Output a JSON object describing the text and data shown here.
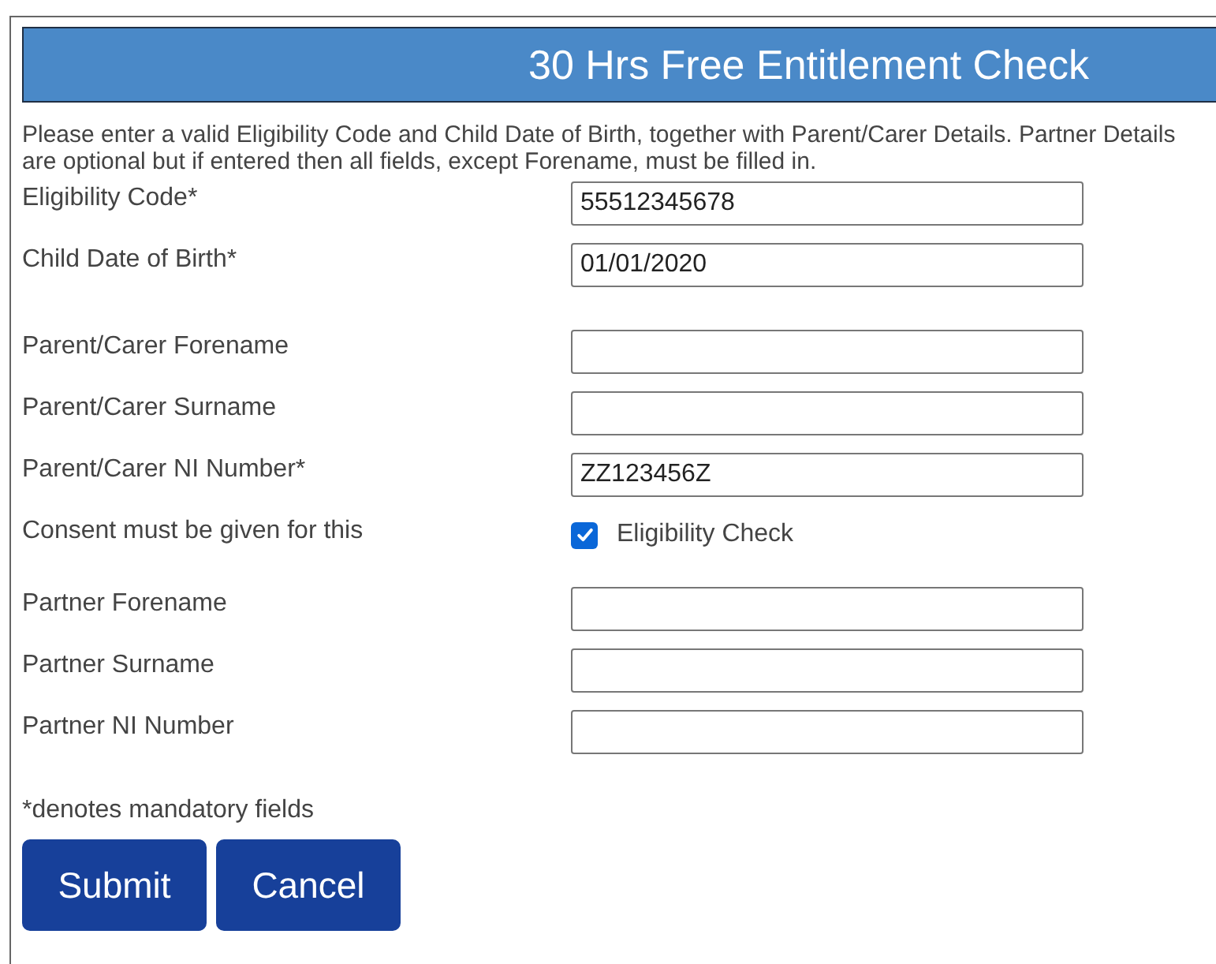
{
  "header": {
    "title": "30 Hrs Free Entitlement Check"
  },
  "intro": "Please enter a valid Eligibility Code and Child Date of Birth, together with Parent/Carer Details. Partner Details are optional but if entered then all fields, except Forename, must be filled in.",
  "sections": [
    [
      {
        "kind": "text",
        "label": "Eligibility Code*",
        "value": "55512345678"
      },
      {
        "kind": "text",
        "label": "Child Date of Birth*",
        "value": "01/01/2020"
      }
    ],
    [
      {
        "kind": "text",
        "label": "Parent/Carer Forename"
      },
      {
        "kind": "text",
        "label": "Parent/Carer Surname"
      },
      {
        "kind": "text",
        "label": "Parent/Carer NI Number*",
        "value": "ZZ123456Z"
      },
      {
        "kind": "checkbox",
        "label": "Consent must be given for this",
        "option": "Eligibility Check",
        "checked": true
      }
    ],
    [
      {
        "kind": "text",
        "label": "Partner Forename"
      },
      {
        "kind": "text",
        "label": "Partner Surname"
      },
      {
        "kind": "text",
        "label": "Partner NI Number"
      }
    ]
  ],
  "note": "*denotes mandatory fields",
  "buttons": [
    "Submit",
    "Cancel"
  ]
}
